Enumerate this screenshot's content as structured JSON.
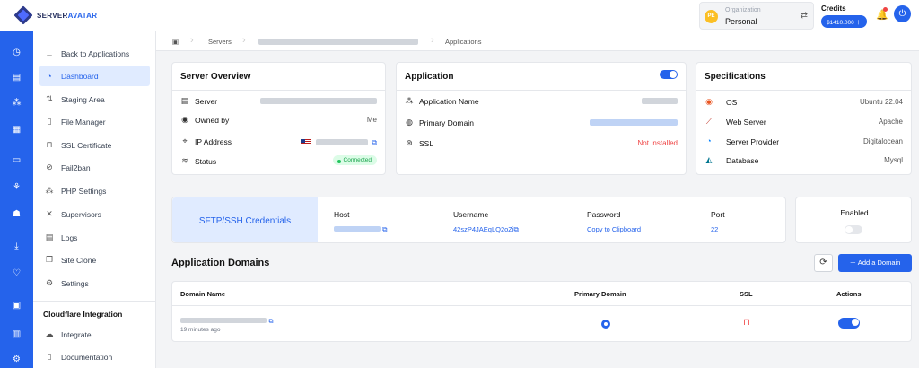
{
  "app": {
    "brand_a": "SERVER",
    "brand_b": "AVATAR"
  },
  "org": {
    "initials": "PE",
    "label": "Organization",
    "name": "Personal"
  },
  "credits": {
    "label": "Credits",
    "amount": "$1410.000 ＋"
  },
  "sidebar": {
    "back": "Back to Applications",
    "items": [
      {
        "label": "Dashboard"
      },
      {
        "label": "Staging Area"
      },
      {
        "label": "File Manager"
      },
      {
        "label": "SSL Certificate"
      },
      {
        "label": "Fail2ban"
      },
      {
        "label": "PHP Settings"
      },
      {
        "label": "Supervisors"
      },
      {
        "label": "Logs"
      },
      {
        "label": "Site Clone"
      },
      {
        "label": "Settings"
      }
    ],
    "section": "Cloudflare Integration",
    "integrate": "Integrate",
    "documentation": "Documentation"
  },
  "breadcrumb": {
    "servers": "Servers",
    "applications": "Applications"
  },
  "server_overview": {
    "title": "Server Overview",
    "server_label": "Server",
    "owned_label": "Owned by",
    "owned_value": "Me",
    "ip_label": "IP Address",
    "status_label": "Status",
    "status_value": "Connected"
  },
  "application": {
    "title": "Application",
    "name_label": "Application Name",
    "domain_label": "Primary Domain",
    "ssl_label": "SSL",
    "ssl_value": "Not Installed"
  },
  "specifications": {
    "title": "Specifications",
    "os_label": "OS",
    "os_value": "Ubuntu 22.04",
    "web_label": "Web Server",
    "web_value": "Apache",
    "provider_label": "Server Provider",
    "provider_value": "Digitalocean",
    "db_label": "Database",
    "db_value": "Mysql"
  },
  "credentials": {
    "title": "SFTP/SSH Credentials",
    "host_label": "Host",
    "username_label": "Username",
    "username_value": "42szP4JAEqLQ2oZi",
    "password_label": "Password",
    "password_value": "Copy to Clipboard",
    "port_label": "Port",
    "port_value": "22",
    "enabled_label": "Enabled"
  },
  "domains": {
    "title": "Application Domains",
    "add_button": "＋ Add a Domain",
    "columns": [
      "Domain Name",
      "Primary Domain",
      "SSL",
      "Actions"
    ],
    "row_time": "19 minutes ago"
  },
  "colors": {
    "accent": "#2563eb",
    "danger": "#ef4444",
    "success": "#16a34a"
  }
}
